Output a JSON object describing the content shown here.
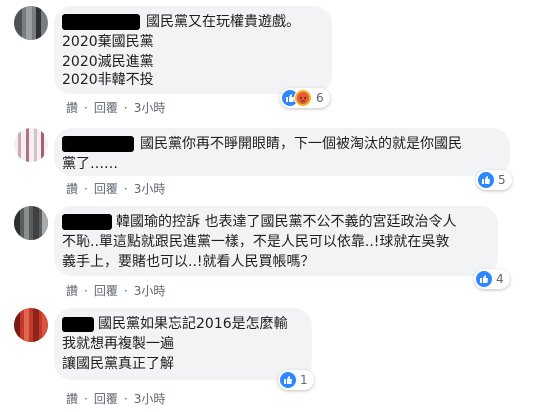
{
  "comments": [
    {
      "lines": [
        "國民黨又在玩權貴遊戲。",
        "2020棄國民黨",
        "2020滅民進黨",
        "2020非韓不投"
      ],
      "like_label": "讚",
      "reply_label": "回覆",
      "time": "3小時",
      "reaction_count": "6",
      "reactions": [
        "like-icon",
        "angry-icon"
      ]
    },
    {
      "lines": [
        "國民黨你再不睜開眼睛，下一個被淘汰的就是你國民",
        "黨了……"
      ],
      "like_label": "讚",
      "reply_label": "回覆",
      "time": "3小時",
      "reaction_count": "5",
      "reactions": [
        "like-icon"
      ]
    },
    {
      "lines": [
        "韓國瑜的控訴 也表達了國民黨不公不義的宮廷政治令人",
        "不恥..單這點就跟民進黨一樣，不是人民可以依靠..!球就在吳敦",
        "義手上，要賭也可以..!就看人民買帳嗎？"
      ],
      "like_label": "讚",
      "reply_label": "回覆",
      "time": "3小時",
      "reaction_count": "4",
      "reactions": [
        "like-icon"
      ]
    },
    {
      "lines": [
        "國民黨如果忘記2016是怎麼輸",
        "我就想再複製一遍",
        "讓國民黨真正了解"
      ],
      "like_label": "讚",
      "reply_label": "回覆",
      "time": "3小時",
      "reaction_count": "1",
      "reactions": [
        "like-icon"
      ]
    }
  ],
  "colors": {
    "bubble": "#f2f3f5",
    "like_blue": "#2d88ff",
    "meta_gray": "#606770",
    "angry_orange": "#f7b125"
  }
}
